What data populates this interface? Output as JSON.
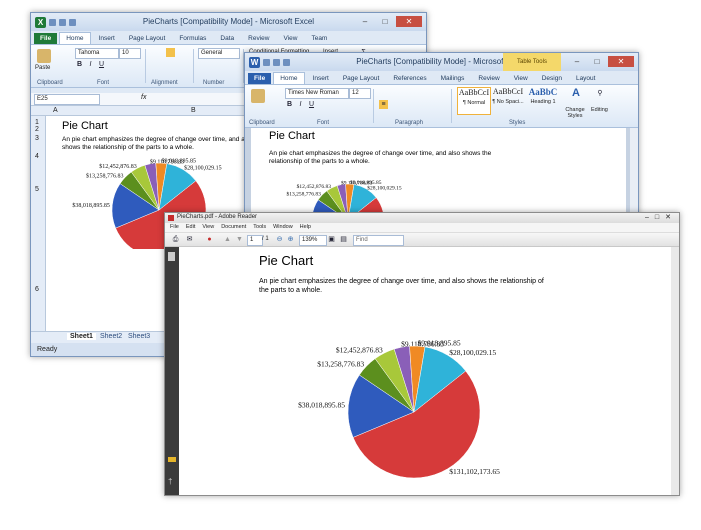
{
  "excel": {
    "title": "PieCharts  [Compatibility Mode] - Microsoft Excel",
    "tabs": [
      "File",
      "Home",
      "Insert",
      "Page Layout",
      "Formulas",
      "Data",
      "Review",
      "View",
      "Team"
    ],
    "font_name": "Tahoma",
    "font_size": "10",
    "number_format": "General",
    "conditional_formatting": "Conditional Formatting",
    "insert_label": "Insert",
    "paste_label": "Paste",
    "groups": [
      "Clipboard",
      "Font",
      "Alignment",
      "Number"
    ],
    "name_box": "E25",
    "fx": "fx",
    "col_a": "A",
    "col_b": "B",
    "rows": [
      "1",
      "2",
      "3",
      "4",
      "5",
      "6"
    ],
    "sheets": [
      "Sheet1",
      "Sheet2",
      "Sheet3"
    ],
    "status": "Ready",
    "pie_title": "Pie Chart",
    "pie_text": "An pie chart emphasizes the degree of change over time, and also shows the relationship of the parts to a whole."
  },
  "word": {
    "title": "PieCharts [Compatibility Mode] - Microsoft Word",
    "table_tools": "Table Tools",
    "tabs": [
      "File",
      "Home",
      "Insert",
      "Page Layout",
      "References",
      "Mailings",
      "Review",
      "View",
      "Design",
      "Layout"
    ],
    "font_name": "Times New Roman",
    "font_size": "12",
    "styles": [
      {
        "sample": "AaBbCcI",
        "name": "¶ Normal"
      },
      {
        "sample": "AaBbCcI",
        "name": "¶ No Spaci..."
      },
      {
        "sample": "AaBbC",
        "name": "Heading 1"
      }
    ],
    "change_styles": "Change Styles",
    "editing": "Editing",
    "groups": [
      "Clipboard",
      "Font",
      "Paragraph",
      "Styles"
    ],
    "pie_title": "Pie Chart",
    "pie_text": "An pie chart emphasizes the degree of change over time, and also shows the relationship of the parts to a whole."
  },
  "reader": {
    "title": "PieCharts.pdf - Adobe Reader",
    "menu": [
      "File",
      "Edit",
      "View",
      "Document",
      "Tools",
      "Window",
      "Help"
    ],
    "page_current": "1",
    "page_total": "/ 1",
    "zoom": "139%",
    "find_placeholder": "Find",
    "pie_title": "Pie Chart",
    "pie_text": "An pie chart emphasizes the degree of change over time, and also shows the relationship of the parts to a whole."
  },
  "chart_data": {
    "type": "pie",
    "labels": [
      "$131,102,173.65",
      "$38,018,895.85",
      "$13,258,776.83",
      "$12,452,876.83",
      "$9,110,786.83",
      "$9,018,895.85",
      "$28,100,029.15"
    ],
    "values": [
      131102173.65,
      38018895.85,
      13258776.83,
      12452876.83,
      9110786.83,
      9018895.85,
      28100029.15
    ],
    "colors": [
      "#d63a3a",
      "#2f5bbd",
      "#5c8f1e",
      "#a8c83a",
      "#8a5fb8",
      "#f08a24",
      "#2fb3d9"
    ]
  }
}
